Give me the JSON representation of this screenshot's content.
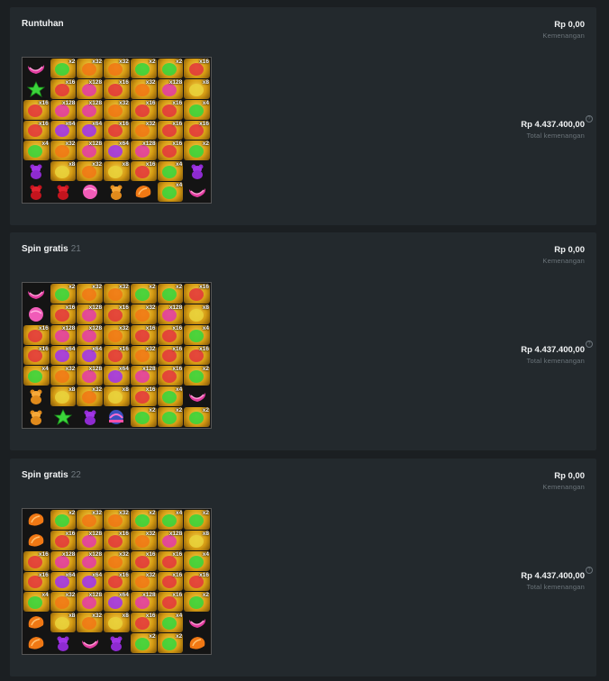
{
  "panels": [
    {
      "title": "Runtuhan",
      "subtitle": "",
      "win_amount": "Rp 0,00",
      "win_label": "Kemenangan",
      "total_amount": "Rp 4.437.400,00",
      "total_label": "Total kemenangan",
      "grid": [
        [
          "pcandy",
          "x2",
          "x32",
          "x32",
          "x2",
          "x2",
          "x16"
        ],
        [
          "gstar",
          "x16",
          "x128",
          "x16",
          "x32",
          "x128",
          "x8"
        ],
        [
          "x16",
          "x128",
          "x128",
          "x32",
          "x16",
          "x16",
          "x4"
        ],
        [
          "x16",
          "x64",
          "x64",
          "x16",
          "x32",
          "x16",
          "x16"
        ],
        [
          "x4",
          "x32",
          "x128",
          "x64",
          "x128",
          "x16",
          "x2"
        ],
        [
          "pbear",
          "x8",
          "x32",
          "x8",
          "x16",
          "x4",
          "pbear"
        ],
        [
          "rbear",
          "rbear",
          "lolly",
          "gbear",
          "ocandy",
          "x4",
          "pcandy"
        ]
      ]
    },
    {
      "title": "Spin gratis",
      "subtitle": "21",
      "win_amount": "Rp 0,00",
      "win_label": "Kemenangan",
      "total_amount": "Rp 4.437.400,00",
      "total_label": "Total kemenangan",
      "grid": [
        [
          "pcandy",
          "x2",
          "x32",
          "x32",
          "x2",
          "x2",
          "x16"
        ],
        [
          "lolly",
          "x16",
          "x128",
          "x16",
          "x32",
          "x128",
          "x8"
        ],
        [
          "x16",
          "x128",
          "x128",
          "x32",
          "x16",
          "x16",
          "x4"
        ],
        [
          "x16",
          "x64",
          "x64",
          "x16",
          "x32",
          "x16",
          "x16"
        ],
        [
          "x4",
          "x32",
          "x128",
          "x64",
          "x128",
          "x16",
          "x2"
        ],
        [
          "gbear",
          "x8",
          "x32",
          "x8",
          "x16",
          "x4",
          "pcandy"
        ],
        [
          "gbear",
          "gstar",
          "pbear",
          "scatter",
          "x2",
          "x2",
          "x2"
        ]
      ]
    },
    {
      "title": "Spin gratis",
      "subtitle": "22",
      "win_amount": "Rp 0,00",
      "win_label": "Kemenangan",
      "total_amount": "Rp 4.437.400,00",
      "total_label": "Total kemenangan",
      "grid": [
        [
          "ocandy",
          "x2",
          "x32",
          "x32",
          "x2",
          "x4",
          "x2"
        ],
        [
          "ocandy",
          "x16",
          "x128",
          "x16",
          "x32",
          "x128",
          "x8"
        ],
        [
          "x16",
          "x128",
          "x128",
          "x32",
          "x16",
          "x16",
          "x4"
        ],
        [
          "x16",
          "x64",
          "x64",
          "x16",
          "x32",
          "x16",
          "x16"
        ],
        [
          "x4",
          "x32",
          "x128",
          "x64",
          "x128",
          "x16",
          "x2"
        ],
        [
          "ocandy",
          "x8",
          "x32",
          "x8",
          "x16",
          "x4",
          "pcandy"
        ],
        [
          "ocandy",
          "pbear",
          "pcandy",
          "pbear",
          "x2",
          "x2",
          "ocandy"
        ]
      ]
    }
  ]
}
